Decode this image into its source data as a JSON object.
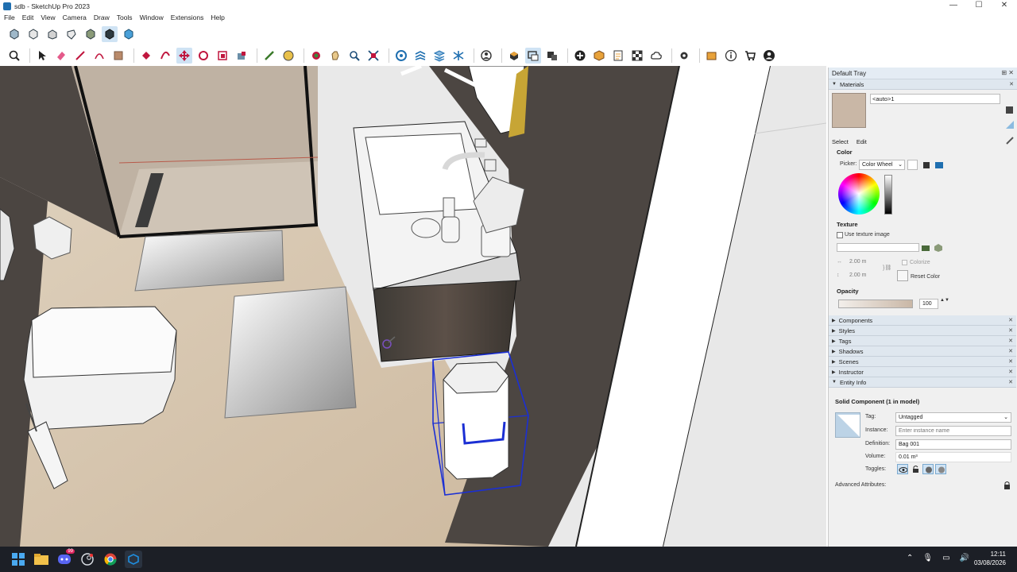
{
  "window": {
    "title": "sdb - SketchUp Pro 2023",
    "min": "—",
    "max": "☐",
    "close": "✕"
  },
  "menu": [
    "File",
    "Edit",
    "View",
    "Camera",
    "Draw",
    "Tools",
    "Window",
    "Extensions",
    "Help"
  ],
  "toolbar1": {
    "icons": [
      "iso-view-icon",
      "top-view-icon",
      "front-view-icon",
      "right-view-icon",
      "back-view-icon",
      "left-view-icon",
      "bottom-view-icon"
    ]
  },
  "toolbar2": {
    "icons": [
      "zoom-icon",
      "select-icon",
      "eraser-icon",
      "line-icon",
      "arc-icon",
      "shape-icon",
      "pushpull-icon",
      "offset-icon",
      "move-icon",
      "rotate-icon",
      "scale-icon",
      "tape-icon",
      "paint-icon",
      "orbit-icon",
      "pan-icon",
      "zoom-window-icon",
      "zoom-extents-icon",
      "section-icon",
      "outliner-icon",
      "layers-icon",
      "styles-icon",
      "account-icon",
      "components-icon",
      "select-bounds-icon",
      "warehouse-icon",
      "add-icon",
      "extension-icon",
      "report-icon",
      "texture-icon",
      "cloud-icon",
      "settings-icon",
      "folder-icon",
      "info-icon",
      "cart-icon",
      "user-icon"
    ]
  },
  "tray": {
    "title": "Default Tray",
    "materials": {
      "header": "Materials",
      "name": "<auto>1",
      "tabs": {
        "select": "Select",
        "edit": "Edit"
      },
      "color_label": "Color",
      "picker_label": "Picker:",
      "picker_value": "Color Wheel",
      "texture_label": "Texture",
      "use_texture": "Use texture image",
      "width": "2.00 m",
      "height": "2.00 m",
      "colorize": "Colorize",
      "reset_color": "Reset Color",
      "opacity_label": "Opacity",
      "opacity_value": "100",
      "swatch_color": "#c9b7a6"
    },
    "panels": [
      "Components",
      "Styles",
      "Tags",
      "Shadows",
      "Scenes",
      "Instructor"
    ],
    "entity_info": {
      "header": "Entity Info",
      "title": "Solid Component (1 in model)",
      "tag_label": "Tag:",
      "tag_value": "Untagged",
      "instance_label": "Instance:",
      "instance_placeholder": "Enter instance name",
      "definition_label": "Definition:",
      "definition_value": "Bag 001",
      "volume_label": "Volume:",
      "volume_value": "0.01 m³",
      "toggles_label": "Toggles:",
      "advanced": "Advanced Attributes:"
    }
  },
  "taskbar": {
    "time": "12:11",
    "date": "03/08/2026",
    "badge": "99"
  }
}
